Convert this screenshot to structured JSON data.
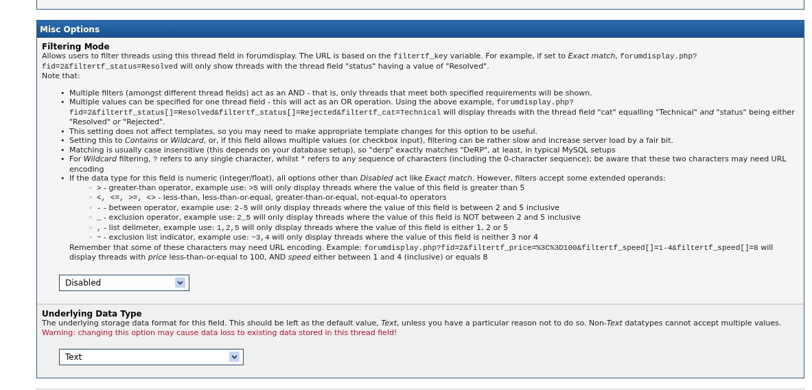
{
  "panel": {
    "title": "Misc Options",
    "settings": [
      {
        "title": "Filtering Mode",
        "paragraphs": [
          [
            {
              "kind": "text",
              "text": "Allows users to filter threads using this thread field in forumdisplay. The URL is based on the "
            },
            {
              "kind": "code",
              "text": "filtertf_key"
            },
            {
              "kind": "text",
              "text": " variable. For example, if set to *Exact match*, "
            },
            {
              "kind": "code",
              "text": "forumdisplay.php?fid=2&filtertf_status=Resolved"
            },
            {
              "kind": "text",
              "text": " will only show threads with the thread field \"status\" having a value of \"Resolved\"."
            }
          ],
          [
            {
              "kind": "text",
              "text": "Note that:"
            }
          ]
        ],
        "bullets": [
          {
            "marker": "•",
            "text": [
              {
                "kind": "text",
                "text": "Multiple filters (amongst different thread fields) act as an AND - that is, only threads that meet both specified requirements will be shown."
              }
            ]
          },
          {
            "marker": "•",
            "text": [
              {
                "kind": "text",
                "text": "Multiple values can be specified for one thread field - this will act as an OR operation. Using the above example, "
              },
              {
                "kind": "code",
                "text": "forumdisplay.php?fid=2&filtertf_status[]=Resolved&filtertf_status[]=Rejected&filtertf_cat=Technical"
              },
              {
                "kind": "text",
                "text": " will display threads with the thread field \"cat\" equalling \"Technical\" *and* \"status\" being either \"Resolved\" *or* \"Rejected\"."
              }
            ]
          },
          {
            "marker": "•",
            "text": [
              {
                "kind": "text",
                "text": "This setting does not affect templates, so you may need to make appropriate template changes for this option to be useful."
              }
            ]
          },
          {
            "marker": "•",
            "text": [
              {
                "kind": "text",
                "text": "Setting this to *Contains* or *Wildcard*, or, if this field allows multiple values (or checkbox input), filtering can be rather slow and increase server load by a fair bit."
              }
            ]
          },
          {
            "marker": "•",
            "text": [
              {
                "kind": "text",
                "text": "Matching is usually case insensitive (this depends on your database setup), so \"derp\" exactly matches \"DeRP\", at least, in typical MySQL setups"
              }
            ]
          },
          {
            "marker": "•",
            "text": [
              {
                "kind": "text",
                "text": "For *Wildcard* filtering, "
              },
              {
                "kind": "code",
                "text": "?"
              },
              {
                "kind": "text",
                "text": " refers to any single character, whilst "
              },
              {
                "kind": "code",
                "text": "*"
              },
              {
                "kind": "text",
                "text": " refers to any sequence of characters (including the 0-character sequence); be aware that these two characters may need URL encoding"
              }
            ]
          },
          {
            "marker": "•",
            "text": [
              {
                "kind": "text",
                "text": "If the data type for this field is numeric (integer/float), all options other than *Disabled* act like *Exact match*. However, filters accept some extended operands:"
              }
            ],
            "children": [
              {
                "marker": "◦",
                "text": [
                  {
                    "kind": "code",
                    "text": ">"
                  },
                  {
                    "kind": "text",
                    "text": " - greater-than operator, example use: "
                  },
                  {
                    "kind": "code",
                    "text": ">5"
                  },
                  {
                    "kind": "text",
                    "text": " will only display threads where the value of this field is greater than 5"
                  }
                ]
              },
              {
                "marker": "◦",
                "text": [
                  {
                    "kind": "code",
                    "text": "<, <=, >=, <>"
                  },
                  {
                    "kind": "text",
                    "text": " - less-than, less-than-or-equal, greater-than-or-equal, not-equal-to operators"
                  }
                ]
              },
              {
                "marker": "◦",
                "text": [
                  {
                    "kind": "code",
                    "text": "-"
                  },
                  {
                    "kind": "text",
                    "text": " - between operator, example use: "
                  },
                  {
                    "kind": "code",
                    "text": "2-5"
                  },
                  {
                    "kind": "text",
                    "text": " will only display threads where the value of this field is between 2 and 5 inclusive"
                  }
                ]
              },
              {
                "marker": "◦",
                "text": [
                  {
                    "kind": "code",
                    "text": "_"
                  },
                  {
                    "kind": "text",
                    "text": " - exclusion operator, example use: "
                  },
                  {
                    "kind": "code",
                    "text": "2_5"
                  },
                  {
                    "kind": "text",
                    "text": " will only display threads where the value of this field is NOT between 2 and 5 inclusive"
                  }
                ]
              },
              {
                "marker": "◦",
                "text": [
                  {
                    "kind": "code",
                    "text": ","
                  },
                  {
                    "kind": "text",
                    "text": " - list delimeter, example use: "
                  },
                  {
                    "kind": "code",
                    "text": "1,2,5"
                  },
                  {
                    "kind": "text",
                    "text": " will only display threads where the value of this field is either 1, 2 or 5"
                  }
                ]
              },
              {
                "marker": "◦",
                "text": [
                  {
                    "kind": "code",
                    "text": "~"
                  },
                  {
                    "kind": "text",
                    "text": " - exclusion list indicator, example use: "
                  },
                  {
                    "kind": "code",
                    "text": "~3,4"
                  },
                  {
                    "kind": "text",
                    "text": " will only display threads where the value of this field is neither 3 nor 4"
                  }
                ]
              }
            ],
            "after": [
              {
                "kind": "text",
                "text": "Remember that some of these characters may need URL encoding. Example: "
              },
              {
                "kind": "code",
                "text": "forumdisplay.php?fid=2&filtertf_price=%3C%3D100&filtertf_speed[]=1-4&filtertf_speed[]=8"
              },
              {
                "kind": "text",
                "text": " will display threads with *price* less-than-or-equal to 100, AND *speed* either between 1 and 4 (inclusive) or equals 8"
              }
            ]
          }
        ],
        "select": {
          "value": "Disabled"
        }
      },
      {
        "title": "Underlying Data Type",
        "paragraphs": [
          [
            {
              "kind": "text",
              "text": "The underlying storage data format for this field. This should be left as the default value, *Text*, unless you have a particular reason not to do so. Non-*Text* datatypes cannot accept multiple values."
            }
          ]
        ],
        "warning": "Warning: changing this option may cause data loss to existing data stored in this thread field!",
        "select": {
          "value": "Text"
        }
      }
    ]
  }
}
